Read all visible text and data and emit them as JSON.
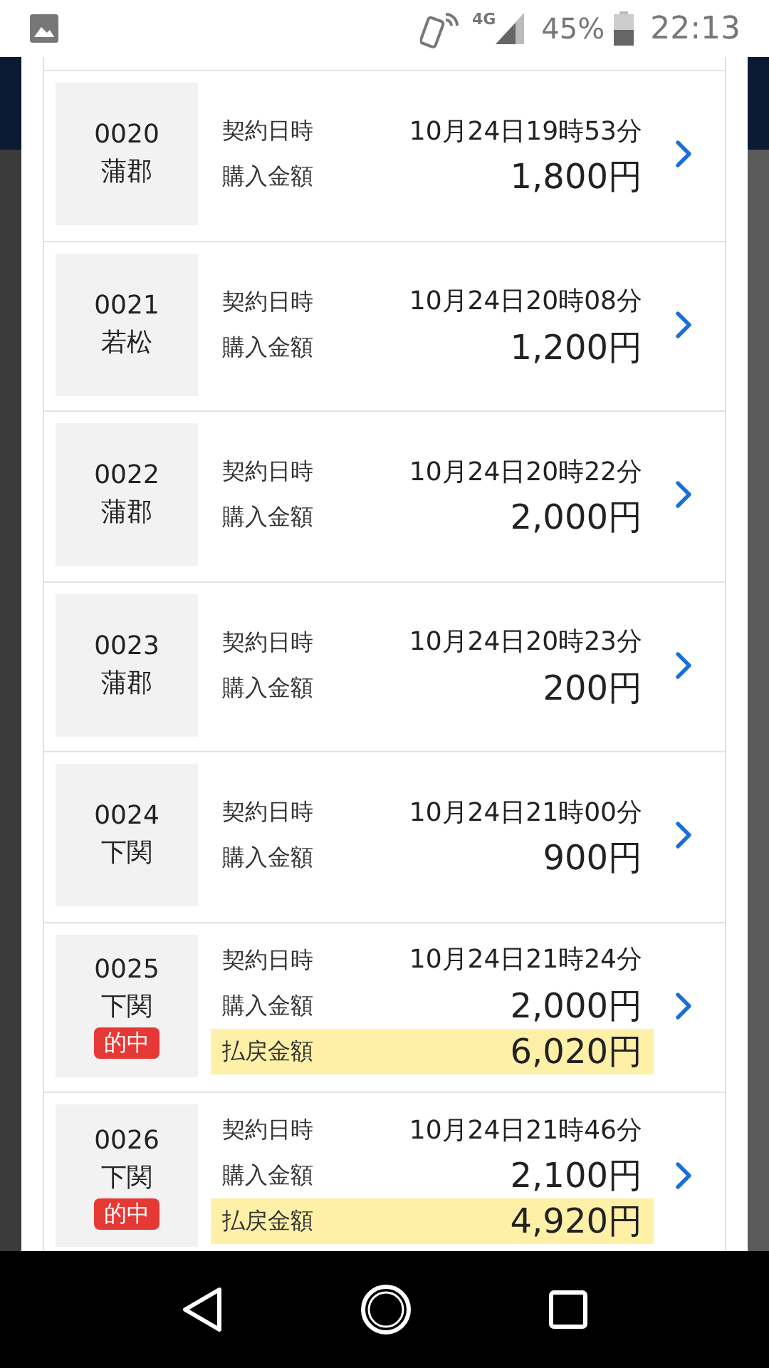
{
  "status_bar": {
    "network": "4G",
    "battery": "45%",
    "time": "22:13"
  },
  "rows": [
    {
      "number": "0020",
      "venue": "蒲郡",
      "fields": [
        {
          "label": "契約日時",
          "value": "10月24日19時53分",
          "kind": "date",
          "highlighted": false
        },
        {
          "label": "購入金額",
          "value": "1,800円",
          "kind": "amount",
          "highlighted": false
        }
      ]
    },
    {
      "number": "0021",
      "venue": "若松",
      "fields": [
        {
          "label": "契約日時",
          "value": "10月24日20時08分",
          "kind": "date",
          "highlighted": false
        },
        {
          "label": "購入金額",
          "value": "1,200円",
          "kind": "amount",
          "highlighted": false
        }
      ]
    },
    {
      "number": "0022",
      "venue": "蒲郡",
      "fields": [
        {
          "label": "契約日時",
          "value": "10月24日20時22分",
          "kind": "date",
          "highlighted": false
        },
        {
          "label": "購入金額",
          "value": "2,000円",
          "kind": "amount",
          "highlighted": false
        }
      ]
    },
    {
      "number": "0023",
      "venue": "蒲郡",
      "fields": [
        {
          "label": "契約日時",
          "value": "10月24日20時23分",
          "kind": "date",
          "highlighted": false
        },
        {
          "label": "購入金額",
          "value": "200円",
          "kind": "amount",
          "highlighted": false
        }
      ]
    },
    {
      "number": "0024",
      "venue": "下関",
      "fields": [
        {
          "label": "契約日時",
          "value": "10月24日21時00分",
          "kind": "date",
          "highlighted": false
        },
        {
          "label": "購入金額",
          "value": "900円",
          "kind": "amount",
          "highlighted": false
        }
      ]
    },
    {
      "number": "0025",
      "venue": "下関",
      "badge": "的中",
      "fields": [
        {
          "label": "契約日時",
          "value": "10月24日21時24分",
          "kind": "date",
          "highlighted": false
        },
        {
          "label": "購入金額",
          "value": "2,000円",
          "kind": "amount",
          "highlighted": false
        },
        {
          "label": "払戻金額",
          "value": "6,020円",
          "kind": "amount",
          "highlighted": true
        }
      ]
    },
    {
      "number": "0026",
      "venue": "下関",
      "badge": "的中",
      "fields": [
        {
          "label": "契約日時",
          "value": "10月24日21時46分",
          "kind": "date",
          "highlighted": false
        },
        {
          "label": "購入金額",
          "value": "2,100円",
          "kind": "amount",
          "highlighted": false
        },
        {
          "label": "払戻金額",
          "value": "4,920円",
          "kind": "amount",
          "highlighted": true
        }
      ]
    }
  ]
}
